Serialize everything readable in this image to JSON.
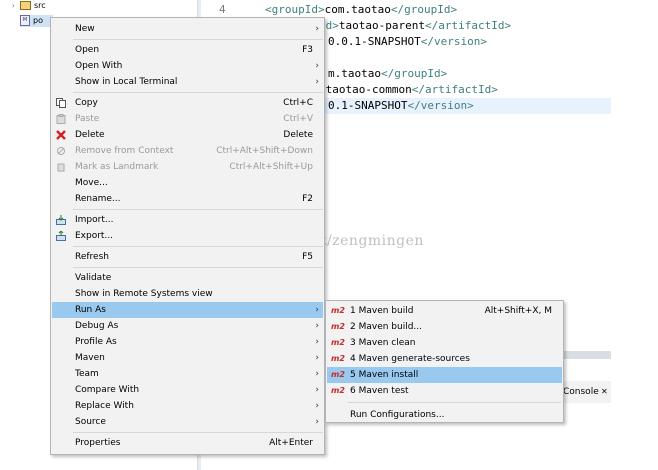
{
  "explorer": {
    "src_label": "src",
    "pom_label": "po"
  },
  "editor": {
    "line_number": "4",
    "lines": [
      {
        "segments": [
          [
            "tag",
            "<groupId>"
          ],
          [
            "txt",
            "com.taotao"
          ],
          [
            "tag",
            "</groupId>"
          ]
        ]
      },
      {
        "segments": [
          [
            "tag",
            "Id>"
          ],
          [
            "txt",
            "taotao-parent"
          ],
          [
            "tag",
            "</artifactId>"
          ]
        ]
      },
      {
        "segments": [
          [
            "txt",
            "0.0.1-SNAPSHOT"
          ],
          [
            "tag",
            "</version>"
          ]
        ]
      },
      {
        "segments": [
          [
            "txt",
            ""
          ]
        ]
      },
      {
        "segments": [
          [
            "txt",
            "m.taotao"
          ],
          [
            "tag",
            "</groupId>"
          ]
        ]
      },
      {
        "segments": [
          [
            "tag",
            ">"
          ],
          [
            "txt",
            "taotao-common"
          ],
          [
            "tag",
            "</artifactId>"
          ]
        ]
      },
      {
        "segments": [
          [
            "txt",
            "0.1-SNAPSHOT"
          ],
          [
            "tag",
            "</version>"
          ]
        ]
      }
    ]
  },
  "watermark": "http://blog.csdn.net/zengmingen",
  "console_tab": "Console",
  "menu": {
    "items": [
      {
        "label": "New",
        "accel": "",
        "submenu": true,
        "icon": ""
      },
      {
        "sep": true
      },
      {
        "label": "Open",
        "accel": "F3",
        "submenu": false,
        "icon": ""
      },
      {
        "label": "Open With",
        "accel": "",
        "submenu": true,
        "icon": ""
      },
      {
        "label": "Show in Local Terminal",
        "accel": "",
        "submenu": true,
        "icon": ""
      },
      {
        "sep": true
      },
      {
        "label": "Copy",
        "accel": "Ctrl+C",
        "submenu": false,
        "icon": "copy-icon"
      },
      {
        "label": "Paste",
        "accel": "Ctrl+V",
        "submenu": false,
        "icon": "paste-icon",
        "disabled": true
      },
      {
        "label": "Delete",
        "accel": "Delete",
        "submenu": false,
        "icon": "delete-icon"
      },
      {
        "label": "Remove from Context",
        "accel": "Ctrl+Alt+Shift+Down",
        "submenu": false,
        "icon": "remove-context-icon",
        "disabled": true
      },
      {
        "label": "Mark as Landmark",
        "accel": "Ctrl+Alt+Shift+Up",
        "submenu": false,
        "icon": "landmark-icon",
        "disabled": true
      },
      {
        "label": "Move...",
        "accel": "",
        "submenu": false,
        "icon": ""
      },
      {
        "label": "Rename...",
        "accel": "F2",
        "submenu": false,
        "icon": ""
      },
      {
        "sep": true
      },
      {
        "label": "Import...",
        "accel": "",
        "submenu": false,
        "icon": "import-icon"
      },
      {
        "label": "Export...",
        "accel": "",
        "submenu": false,
        "icon": "export-icon"
      },
      {
        "sep": true
      },
      {
        "label": "Refresh",
        "accel": "F5",
        "submenu": false,
        "icon": ""
      },
      {
        "sep": true
      },
      {
        "label": "Validate",
        "accel": "",
        "submenu": false,
        "icon": ""
      },
      {
        "label": "Show in Remote Systems view",
        "accel": "",
        "submenu": false,
        "icon": ""
      },
      {
        "label": "Run As",
        "accel": "",
        "submenu": true,
        "icon": "",
        "selected": true
      },
      {
        "label": "Debug As",
        "accel": "",
        "submenu": true,
        "icon": ""
      },
      {
        "label": "Profile As",
        "accel": "",
        "submenu": true,
        "icon": ""
      },
      {
        "label": "Maven",
        "accel": "",
        "submenu": true,
        "icon": ""
      },
      {
        "label": "Team",
        "accel": "",
        "submenu": true,
        "icon": ""
      },
      {
        "label": "Compare With",
        "accel": "",
        "submenu": true,
        "icon": ""
      },
      {
        "label": "Replace With",
        "accel": "",
        "submenu": true,
        "icon": ""
      },
      {
        "label": "Source",
        "accel": "",
        "submenu": true,
        "icon": ""
      },
      {
        "sep": true
      },
      {
        "label": "Properties",
        "accel": "Alt+Enter",
        "submenu": false,
        "icon": ""
      }
    ]
  },
  "submenu": {
    "badge": "m2",
    "items": [
      {
        "label": "1 Maven build",
        "accel": "Alt+Shift+X, M",
        "badge": true
      },
      {
        "label": "2 Maven build...",
        "accel": "",
        "badge": true
      },
      {
        "label": "3 Maven clean",
        "accel": "",
        "badge": true
      },
      {
        "label": "4 Maven generate-sources",
        "accel": "",
        "badge": true
      },
      {
        "label": "5 Maven install",
        "accel": "",
        "badge": true,
        "selected": true
      },
      {
        "label": "6 Maven test",
        "accel": "",
        "badge": true
      },
      {
        "sep": true
      },
      {
        "label": "Run Configurations...",
        "accel": "",
        "badge": false
      }
    ]
  },
  "colors": {
    "selection": "#99c9ef",
    "menu_bg": "#f2f2f2",
    "xml_tag": "#3f7f7f",
    "m2_badge": "#c62a2a"
  }
}
